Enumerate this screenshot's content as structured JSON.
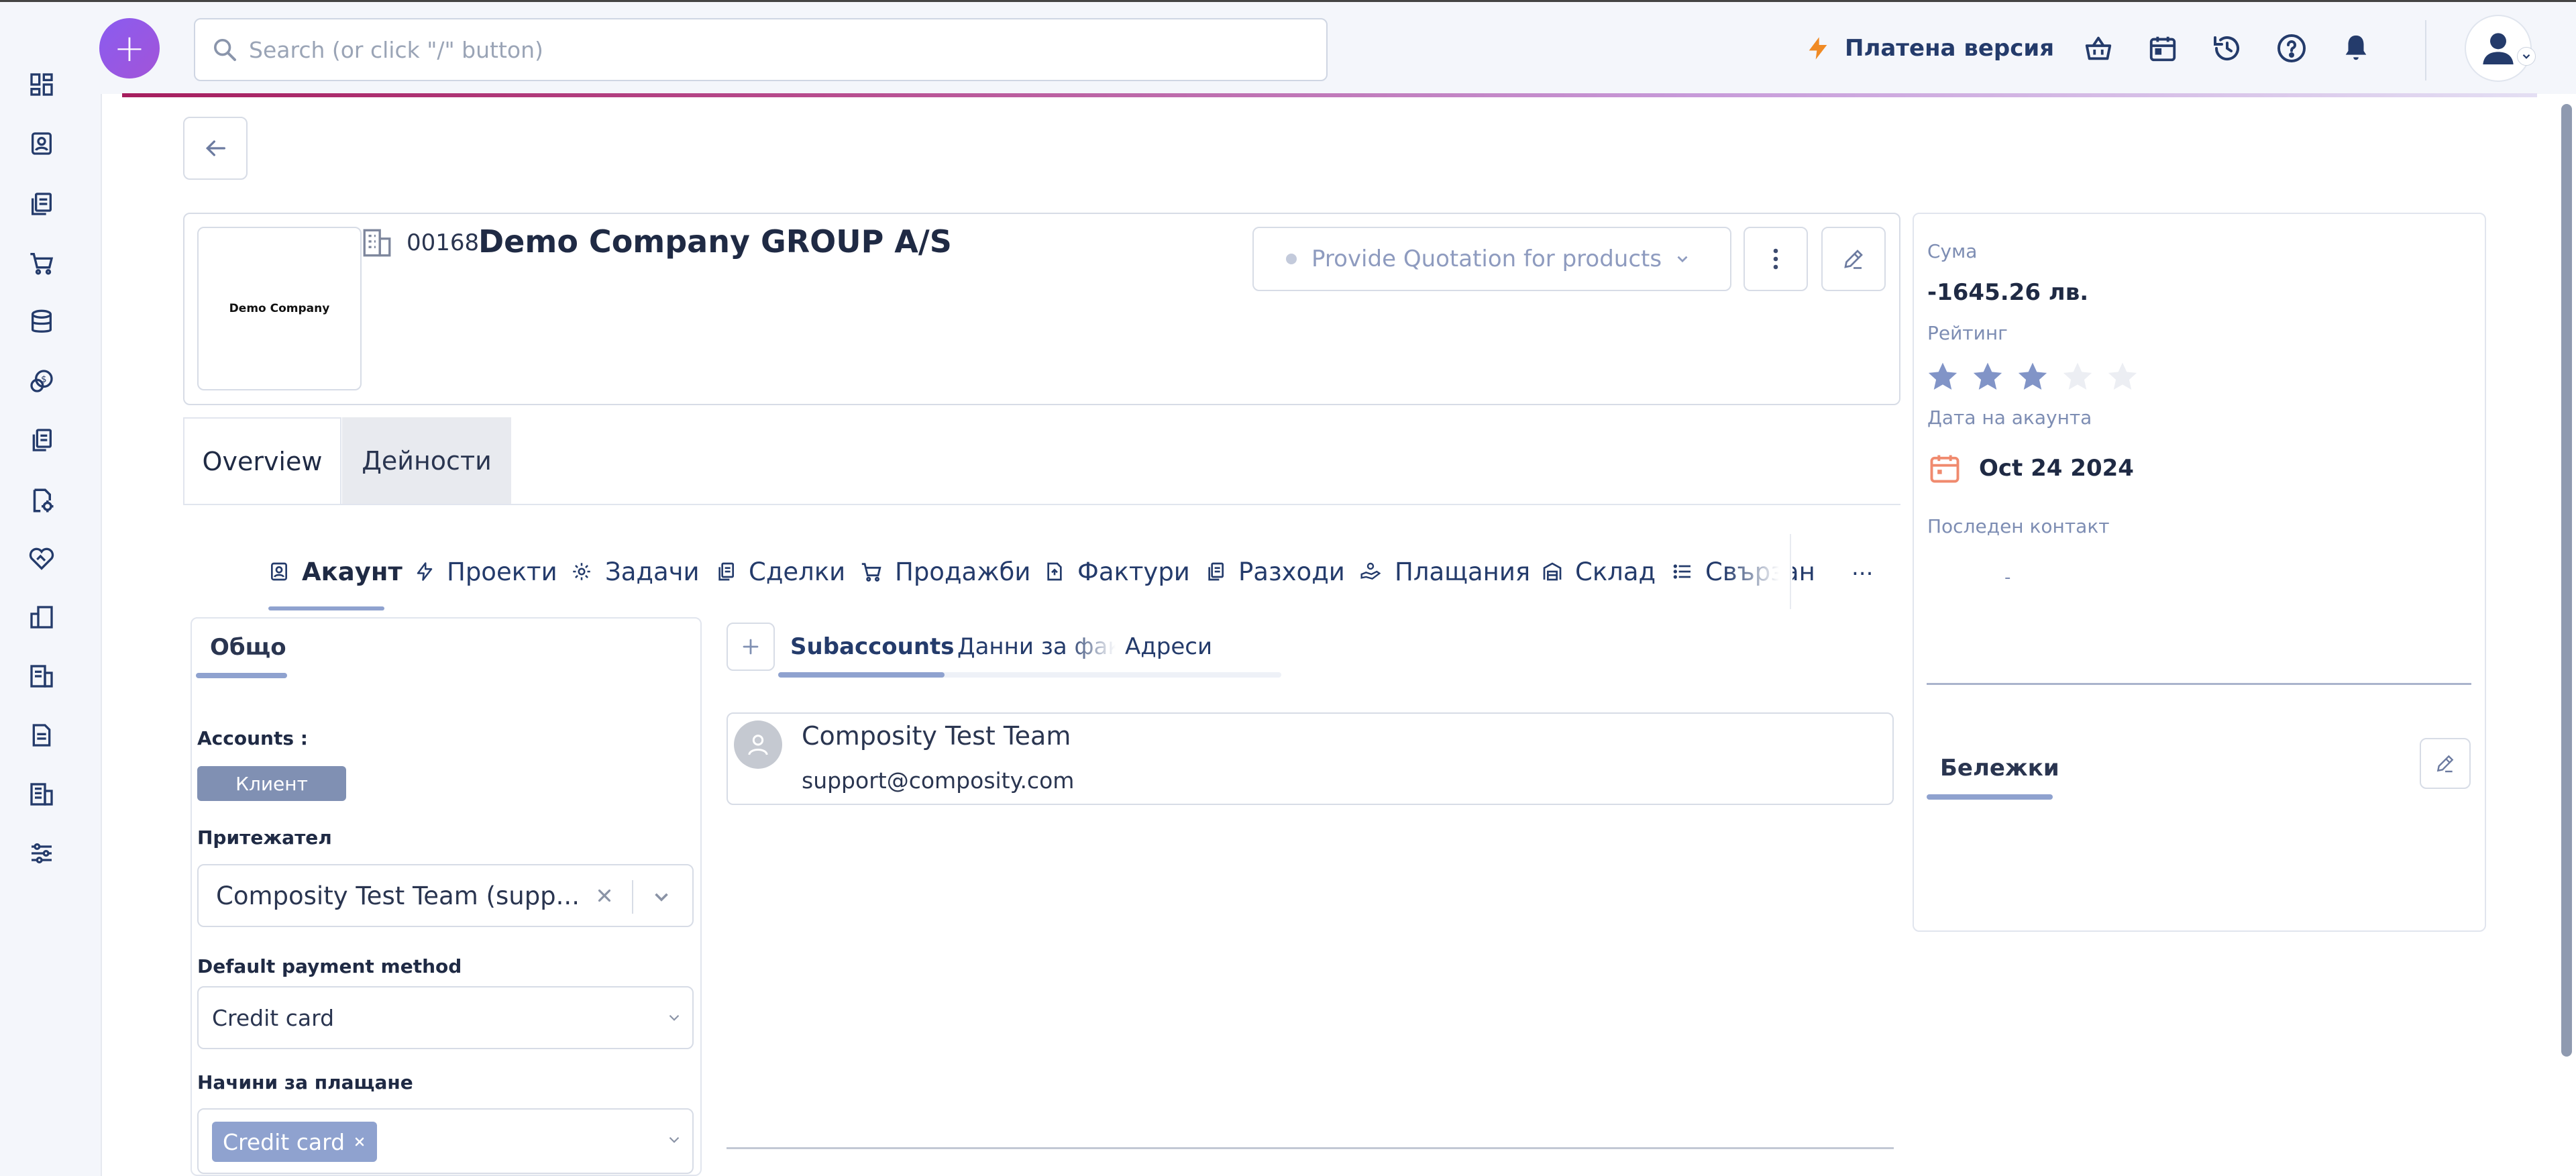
{
  "topbar": {
    "search_placeholder": "Search (or click \"/\" button)",
    "paid_label": "Платена версия",
    "icons": [
      "basket-icon",
      "calendar-icon",
      "history-icon",
      "help-icon",
      "bell-icon"
    ]
  },
  "sidebar": {
    "items": [
      "dashboard-icon",
      "contacts-icon",
      "documents-icon",
      "cart-icon",
      "database-icon",
      "finance-icon",
      "files-icon",
      "settings-doc-icon",
      "handshake-icon",
      "projects-icon",
      "reports-icon",
      "notes-icon",
      "building-icon",
      "sliders-icon"
    ]
  },
  "account": {
    "logo_text": "Demo Company",
    "number": "00168",
    "name": "Demo Company GROUP A/S",
    "stage": "Provide Quotation for products"
  },
  "summary": {
    "amount_label": "Сума",
    "amount_value": "-1645.26 лв.",
    "rating_label": "Рейтинг",
    "rating": 3,
    "rating_max": 5,
    "date_label": "Дата на акаунта",
    "date_value": "Oct 24 2024",
    "last_contact_label": "Последен контакт",
    "last_contact_value": "-",
    "notes_label": "Бележки"
  },
  "tabs": {
    "overview": "Overview",
    "activities": "Дейности"
  },
  "subtabs": [
    {
      "label": "Акаунт",
      "icon": "account-icon"
    },
    {
      "label": "Проекти",
      "icon": "bolt-icon"
    },
    {
      "label": "Задачи",
      "icon": "tasks-icon"
    },
    {
      "label": "Сделки",
      "icon": "deals-icon"
    },
    {
      "label": "Продажби",
      "icon": "cart-icon"
    },
    {
      "label": "Фактури",
      "icon": "invoice-icon"
    },
    {
      "label": "Разходи",
      "icon": "expenses-icon"
    },
    {
      "label": "Плащания",
      "icon": "payments-icon"
    },
    {
      "label": "Склад",
      "icon": "warehouse-icon"
    },
    {
      "label": "Свързан",
      "icon": "list-icon"
    }
  ],
  "subtabs_more": "...",
  "general": {
    "tab_label": "Общо",
    "accounts_label": "Accounts :",
    "accounts_chip": "Клиент",
    "owner_label": "Притежател",
    "owner_value": "Composity Test Team (supp...",
    "payment_label": "Default payment method",
    "payment_value": "Credit card",
    "methods_label": "Начини за плащане",
    "methods_chip": "Credit card"
  },
  "subaccounts": {
    "tabs": [
      "Subaccounts",
      "Данни за фактура",
      "Адреси"
    ],
    "items": [
      {
        "name": "Composity Test Team",
        "email": "support@composity.com"
      }
    ]
  }
}
